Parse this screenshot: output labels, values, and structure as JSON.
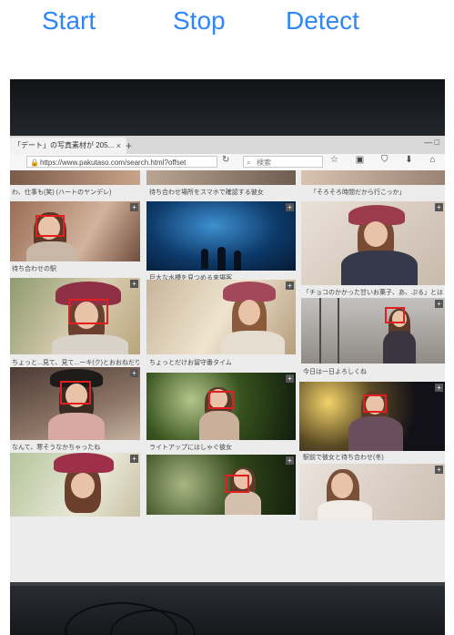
{
  "toolbar": {
    "start_label": "Start",
    "stop_label": "Stop",
    "detect_label": "Detect",
    "accent_color": "#2f86f6"
  },
  "browser": {
    "tab_title": "「デート」の写真素材が 205...",
    "tab_close_icon": "×",
    "new_tab_icon": "+",
    "window_controls": "—  □",
    "url": "https://www.pakutaso.com/search.html?offset",
    "search_placeholder": "検索",
    "toolbar_icons": "☆ ▣ ⛉ ⬇ ⌂ ☻"
  },
  "captions": [
    "わ、仕事も(笑) (ハートのヤンデレ)",
    "待ち合わせ場所をスマホで確認する彼女",
    "「そろそろ時間だから行こっか」",
    "待ち合わせの駅",
    "巨大な水槽を見つめる来場客",
    "「チョコのかかった甘いお菓子、あ、ぷる」とはにかむ美女",
    "ちょっと...見て、見て...ーキ(ク)とおおねだりするガール",
    "ちょっとだけお留守番タイム",
    "今日は一日よろしくね",
    "なんて、寒そうなかちゃったね",
    "ライトアップにはしゃぐ彼女",
    "駅前で彼女と待ち合わせ(冬)"
  ],
  "detection": {
    "box_color": "#e21e1e",
    "detected_faces": 8
  }
}
